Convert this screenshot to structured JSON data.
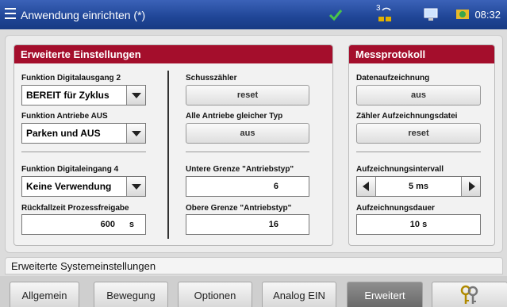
{
  "titlebar": {
    "title": "Anwendung einrichten (*)",
    "time": "08:32",
    "status_sub": "3"
  },
  "left_panel": {
    "header": "Erweiterte Einstellungen",
    "digital_out_label": "Funktion Digitalausgang 2",
    "digital_out_value": "BEREIT für Zyklus",
    "drives_label": "Funktion Antriebe AUS",
    "drives_value": "Parken und AUS",
    "digital_in_label": "Funktion Digitaleingang 4",
    "digital_in_value": "Keine Verwendung",
    "fallback_label": "Rückfallzeit Prozessfreigabe",
    "fallback_value": "600",
    "fallback_unit": "s",
    "shot_counter_label": "Schusszähler",
    "shot_counter_button": "reset",
    "same_type_label": "Alle Antriebe gleicher Typ",
    "same_type_button": "aus",
    "lower_limit_label": "Untere Grenze \"Antriebstyp\"",
    "lower_limit_value": "6",
    "upper_limit_label": "Obere Grenze \"Antriebstyp\"",
    "upper_limit_value": "16"
  },
  "right_panel": {
    "header": "Messprotokoll",
    "recording_label": "Datenaufzeichnung",
    "recording_button": "aus",
    "counter_file_label": "Zähler Aufzeichnungsdatei",
    "counter_file_button": "reset",
    "interval_label": "Aufzeichnungsintervall",
    "interval_value": "5 ms",
    "duration_label": "Aufzeichnungsdauer",
    "duration_value": "10 s"
  },
  "section_title": "Erweiterte Systemeinstellungen",
  "tabs": [
    "Allgemein",
    "Bewegung",
    "Optionen",
    "Analog EIN",
    "Erweitert"
  ],
  "colors": {
    "accent": "#a40e2c",
    "titlebar": "#1f4596",
    "active_tab": "#7a7a7a"
  }
}
